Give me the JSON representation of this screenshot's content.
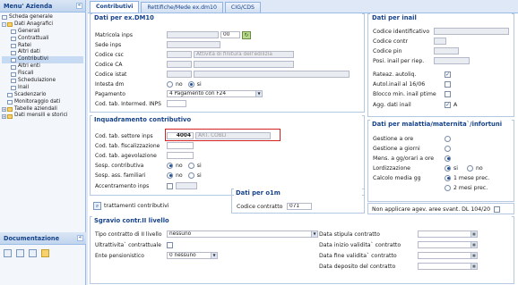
{
  "sidebar": {
    "title": "Menu' Azienda",
    "items": [
      {
        "label": "Scheda generale"
      },
      {
        "label": "Dati Anagrafici"
      },
      {
        "label": "Generali"
      },
      {
        "label": "Contrattuali"
      },
      {
        "label": "Ratei"
      },
      {
        "label": "Altri dati"
      },
      {
        "label": "Contributivi"
      },
      {
        "label": "Altri enti"
      },
      {
        "label": "Fiscali"
      },
      {
        "label": "Schedulazione"
      },
      {
        "label": "Inail"
      },
      {
        "label": "Scadenzario"
      },
      {
        "label": "Monitoraggio dati"
      },
      {
        "label": "Tabelle aziendali"
      },
      {
        "label": "Dati mensili e storici"
      }
    ]
  },
  "documentazione": {
    "title": "Documentazione"
  },
  "tabs": [
    {
      "label": "Contributivi"
    },
    {
      "label": "Rettifiche/Mede ex.dm10"
    },
    {
      "label": "CIG/CDS"
    }
  ],
  "dm10": {
    "title": "Dati per ex.DM10",
    "matricola_label": "Matricola inps",
    "matricola_suffix": "00",
    "sede_label": "Sede inps",
    "csc_label": "Codice csc",
    "csc_value": "Attività di finitura dell'edilizia",
    "ca_label": "Codice CA",
    "istat_label": "Codice istat",
    "intesta_label": "Intesta dm",
    "intesta_no": "no",
    "intesta_si": "si",
    "pagamento_label": "Pagamento",
    "pagamento_value": "4 Pagamento con F24",
    "tab_interm_label": "Cod. tab. Intermed. INPS"
  },
  "inquadramento": {
    "title": "Inquadramento contributivo",
    "settore_label": "Cod. tab. settore inps",
    "settore_code": "4004",
    "settore_desc": "ART. COBLI",
    "fiscalizzazione_label": "Cod. tab. fiscalizzazione",
    "agevolazione_label": "Cod. tab. agevolazione",
    "sosp_contrib_label": "Sosp. contributiva",
    "sosp_assegni_label": "Sosp. ass. familiari",
    "no": "no",
    "si": "si",
    "accentramento_label": "Accentramento inps"
  },
  "trattamenti": {
    "label": "trattamenti contributivi"
  },
  "o1m": {
    "title": "Dati per o1m",
    "codice_label": "Codice contratto",
    "codice_value": "071"
  },
  "sgravio": {
    "title": "Sgravio contr.II livello",
    "tipo_label": "Tipo contratto di II livello",
    "tipo_value": "nessuno",
    "ultrattivita_label": "Ultrattivita` contrattuale",
    "ente_label": "Ente pensionistico",
    "ente_value": "0 nessuno",
    "stipula_label": "Data stipula contratto",
    "inizio_label": "Data inizio validita` contratto",
    "fine_label": "Data fine validita` contratto",
    "deposito_label": "Data deposito del contratto"
  },
  "inail": {
    "title": "Dati per inail",
    "cod_ident_label": "Codice identificativo",
    "cod_contr_label": "Codice contr",
    "cod_pin_label": "Codice pin",
    "posi_label": "Posi. inail per riep.",
    "rateaz_label": "Rateaz. autoliq.",
    "autol_label": "Autol.inail al 16/06",
    "blocco_label": "Blocco min. inail ptime",
    "agg_label": "Agg. dati inail",
    "agg_value": "A"
  },
  "malattia": {
    "title": "Dati per malattia/maternita`/infortuni",
    "gest_ore_label": "Gestione a ore",
    "gest_giorni_label": "Gestione a giorni",
    "mens_label": "Mens. a gg/orari a ore",
    "lordizz_label": "Lordizzazione",
    "si": "si",
    "no": "no",
    "calcolo_label": "Calcolo media gg",
    "mese1": "1 mese prec.",
    "mese2": "2 mesi prec."
  },
  "agev": {
    "label": "Non applicare agev. aree svant. DL 104/20"
  }
}
